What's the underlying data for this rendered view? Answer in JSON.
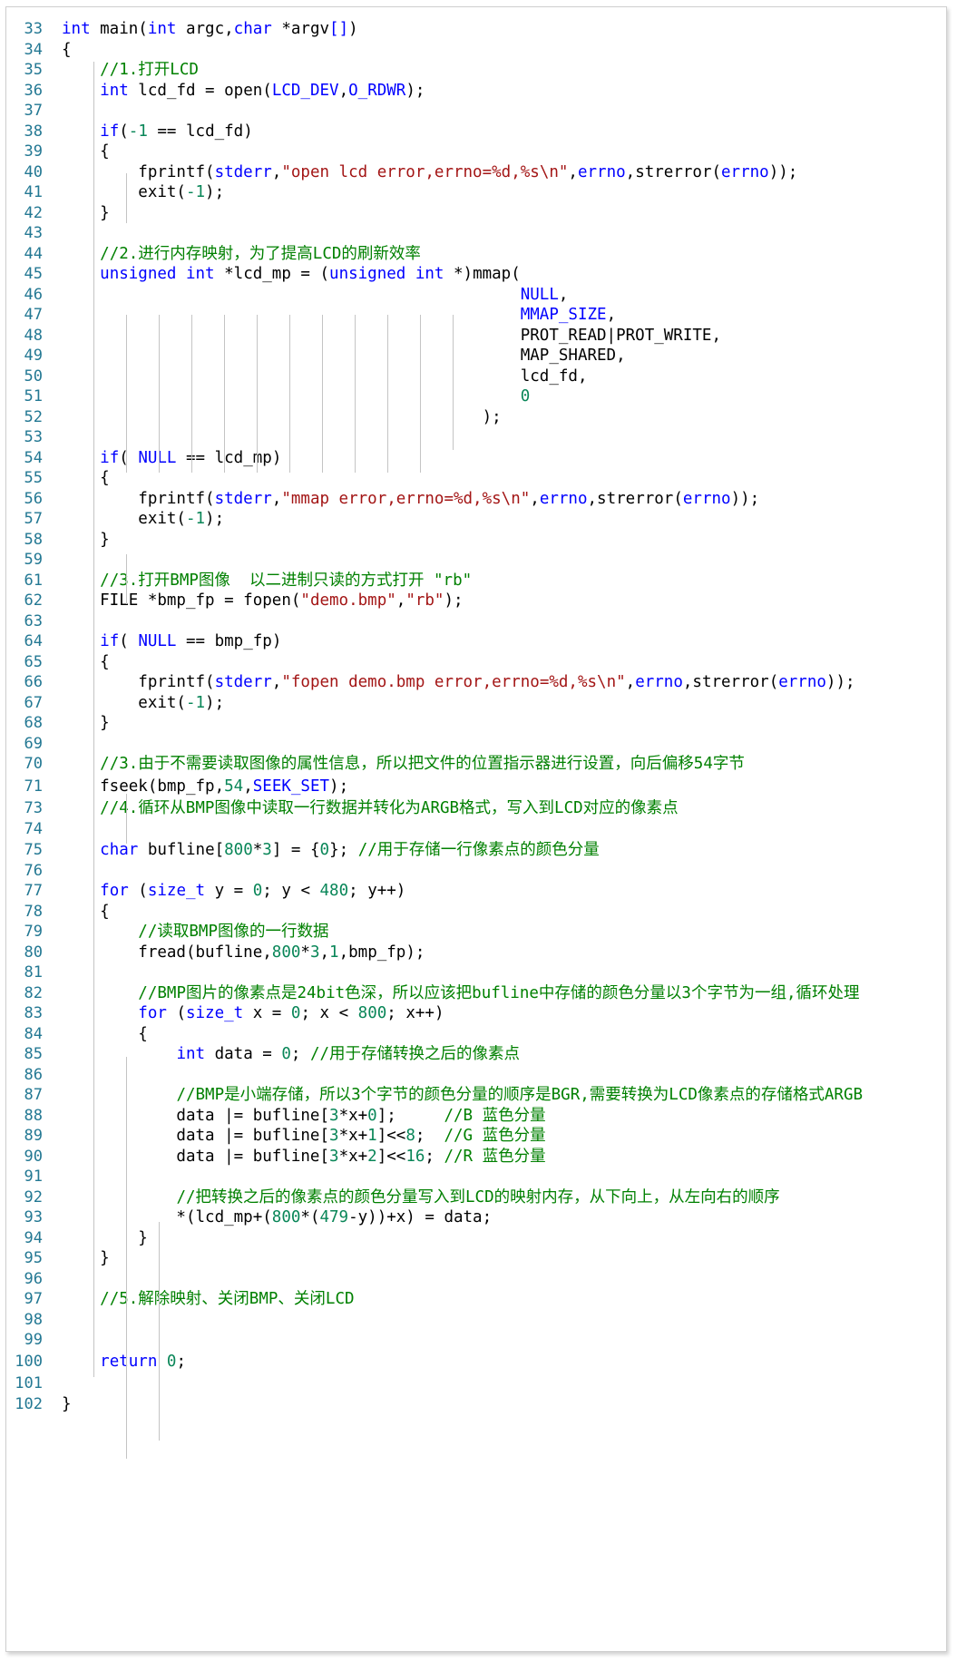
{
  "editor": {
    "colors": {
      "keyword": "#0000ff",
      "comment": "#008000",
      "string": "#a31515",
      "number": "#098658",
      "line_number": "#237893"
    },
    "lines": [
      {
        "n": "33",
        "segs": [
          [
            "kw",
            "int"
          ],
          [
            "",
            " main("
          ],
          [
            "kw",
            "int"
          ],
          [
            "",
            " argc,"
          ],
          [
            "kw",
            "char"
          ],
          [
            "",
            " *argv"
          ],
          [
            "kw",
            "[]"
          ],
          [
            "",
            ")"
          ]
        ]
      },
      {
        "n": "34",
        "segs": [
          [
            "",
            "{"
          ]
        ]
      },
      {
        "n": "35",
        "segs": [
          [
            "",
            "    "
          ],
          [
            "cm",
            "//1.打开LCD"
          ]
        ]
      },
      {
        "n": "36",
        "segs": [
          [
            "",
            "    "
          ],
          [
            "kw",
            "int"
          ],
          [
            "",
            " lcd_fd = open("
          ],
          [
            "mc",
            "LCD_DEV"
          ],
          [
            "",
            ","
          ],
          [
            "mc",
            "O_RDWR"
          ],
          [
            "",
            ");"
          ]
        ]
      },
      {
        "n": "37",
        "segs": []
      },
      {
        "n": "38",
        "segs": [
          [
            "",
            "    "
          ],
          [
            "kw",
            "if"
          ],
          [
            "",
            "("
          ],
          [
            "nm",
            "-1"
          ],
          [
            "",
            " == lcd_fd)"
          ]
        ]
      },
      {
        "n": "39",
        "segs": [
          [
            "",
            "    {"
          ]
        ]
      },
      {
        "n": "40",
        "segs": [
          [
            "",
            "        fprintf("
          ],
          [
            "mc",
            "stderr"
          ],
          [
            "",
            ","
          ],
          [
            "st",
            "\"open lcd error,errno=%d,%s\\n\""
          ],
          [
            "",
            ","
          ],
          [
            "mc",
            "errno"
          ],
          [
            "",
            ",strerror("
          ],
          [
            "mc",
            "errno"
          ],
          [
            "",
            "));"
          ]
        ]
      },
      {
        "n": "41",
        "segs": [
          [
            "",
            "        exit("
          ],
          [
            "nm",
            "-1"
          ],
          [
            "",
            ");"
          ]
        ]
      },
      {
        "n": "42",
        "segs": [
          [
            "",
            "    }"
          ]
        ]
      },
      {
        "n": "43",
        "segs": []
      },
      {
        "n": "44",
        "segs": [
          [
            "",
            "    "
          ],
          [
            "cm",
            "//2.进行内存映射，为了提高LCD的刷新效率"
          ]
        ]
      },
      {
        "n": "45",
        "segs": [
          [
            "",
            "    "
          ],
          [
            "kw",
            "unsigned int"
          ],
          [
            "",
            " *lcd_mp = ("
          ],
          [
            "kw",
            "unsigned int"
          ],
          [
            "",
            " *)mmap("
          ]
        ]
      },
      {
        "n": "46",
        "segs": [
          [
            "",
            "                                                "
          ],
          [
            "mc",
            "NULL"
          ],
          [
            "",
            ","
          ]
        ]
      },
      {
        "n": "47",
        "segs": [
          [
            "",
            "                                                "
          ],
          [
            "mc",
            "MMAP_SIZE"
          ],
          [
            "",
            ","
          ]
        ]
      },
      {
        "n": "48",
        "segs": [
          [
            "",
            "                                                PROT_READ|PROT_WRITE,"
          ]
        ]
      },
      {
        "n": "49",
        "segs": [
          [
            "",
            "                                                MAP_SHARED,"
          ]
        ]
      },
      {
        "n": "50",
        "segs": [
          [
            "",
            "                                                lcd_fd,"
          ]
        ]
      },
      {
        "n": "51",
        "segs": [
          [
            "",
            "                                                "
          ],
          [
            "nm",
            "0"
          ]
        ]
      },
      {
        "n": "52",
        "segs": [
          [
            "",
            "                                            );"
          ]
        ]
      },
      {
        "n": "53",
        "segs": []
      },
      {
        "n": "54",
        "segs": [
          [
            "",
            "    "
          ],
          [
            "kw",
            "if"
          ],
          [
            "",
            "( "
          ],
          [
            "mc",
            "NULL"
          ],
          [
            "",
            " == lcd_mp)"
          ]
        ]
      },
      {
        "n": "55",
        "segs": [
          [
            "",
            "    {"
          ]
        ]
      },
      {
        "n": "56",
        "segs": [
          [
            "",
            "        fprintf("
          ],
          [
            "mc",
            "stderr"
          ],
          [
            "",
            ","
          ],
          [
            "st",
            "\"mmap error,errno=%d,%s\\n\""
          ],
          [
            "",
            ","
          ],
          [
            "mc",
            "errno"
          ],
          [
            "",
            ",strerror("
          ],
          [
            "mc",
            "errno"
          ],
          [
            "",
            "));"
          ]
        ]
      },
      {
        "n": "57",
        "segs": [
          [
            "",
            "        exit("
          ],
          [
            "nm",
            "-1"
          ],
          [
            "",
            ");"
          ]
        ]
      },
      {
        "n": "58",
        "segs": [
          [
            "",
            "    }"
          ]
        ]
      },
      {
        "n": "59",
        "segs": []
      },
      {
        "n": "61",
        "segs": [
          [
            "",
            "    "
          ],
          [
            "cm",
            "//3.打开BMP图像  以二进制只读的方式打开 \"rb\""
          ]
        ]
      },
      {
        "n": "62",
        "segs": [
          [
            "",
            "    FILE *bmp_fp = fopen("
          ],
          [
            "st",
            "\"demo.bmp\""
          ],
          [
            "",
            ","
          ],
          [
            "st",
            "\"rb\""
          ],
          [
            "",
            ");"
          ]
        ]
      },
      {
        "n": "63",
        "segs": []
      },
      {
        "n": "64",
        "segs": [
          [
            "",
            "    "
          ],
          [
            "kw",
            "if"
          ],
          [
            "",
            "( "
          ],
          [
            "mc",
            "NULL"
          ],
          [
            "",
            " == bmp_fp)"
          ]
        ]
      },
      {
        "n": "65",
        "segs": [
          [
            "",
            "    {"
          ]
        ]
      },
      {
        "n": "66",
        "segs": [
          [
            "",
            "        fprintf("
          ],
          [
            "mc",
            "stderr"
          ],
          [
            "",
            ","
          ],
          [
            "st",
            "\"fopen demo.bmp error,errno=%d,%s\\n\""
          ],
          [
            "",
            ","
          ],
          [
            "mc",
            "errno"
          ],
          [
            "",
            ",strerror("
          ],
          [
            "mc",
            "errno"
          ],
          [
            "",
            "));"
          ]
        ]
      },
      {
        "n": "67",
        "segs": [
          [
            "",
            "        exit("
          ],
          [
            "nm",
            "-1"
          ],
          [
            "",
            ");"
          ]
        ]
      },
      {
        "n": "68",
        "segs": [
          [
            "",
            "    }"
          ]
        ]
      },
      {
        "n": "69",
        "segs": []
      },
      {
        "n": "70",
        "segs": [
          [
            "",
            "    "
          ],
          [
            "cm",
            "//3.由于不需要读取图像的属性信息，所以把文件的位置指示器进行设置，向后偏移54字节"
          ]
        ]
      },
      {
        "n": "71",
        "segs": [
          [
            "",
            "    fseek(bmp_fp,"
          ],
          [
            "nm",
            "54"
          ],
          [
            "",
            ","
          ],
          [
            "mc",
            "SEEK_SET"
          ],
          [
            "",
            ");"
          ]
        ]
      },
      {
        "n": "73",
        "segs": [
          [
            "",
            "    "
          ],
          [
            "cm",
            "//4.循环从BMP图像中读取一行数据并转化为ARGB格式，写入到LCD对应的像素点"
          ]
        ]
      },
      {
        "n": "74",
        "segs": []
      },
      {
        "n": "75",
        "segs": [
          [
            "",
            "    "
          ],
          [
            "kw",
            "char"
          ],
          [
            "",
            " bufline["
          ],
          [
            "nm",
            "800"
          ],
          [
            "",
            "*"
          ],
          [
            "nm",
            "3"
          ],
          [
            "",
            "] = {"
          ],
          [
            "nm",
            "0"
          ],
          [
            "",
            "}; "
          ],
          [
            "cm",
            "//用于存储一行像素点的颜色分量"
          ]
        ]
      },
      {
        "n": "76",
        "segs": []
      },
      {
        "n": "77",
        "segs": [
          [
            "",
            "    "
          ],
          [
            "kw",
            "for"
          ],
          [
            "",
            " ("
          ],
          [
            "kw",
            "size_t"
          ],
          [
            "",
            " y = "
          ],
          [
            "nm",
            "0"
          ],
          [
            "",
            "; y < "
          ],
          [
            "nm",
            "480"
          ],
          [
            "",
            "; y++)"
          ]
        ]
      },
      {
        "n": "78",
        "segs": [
          [
            "",
            "    {"
          ]
        ]
      },
      {
        "n": "79",
        "segs": [
          [
            "",
            "        "
          ],
          [
            "cm",
            "//读取BMP图像的一行数据"
          ]
        ]
      },
      {
        "n": "80",
        "segs": [
          [
            "",
            "        fread(bufline,"
          ],
          [
            "nm",
            "800"
          ],
          [
            "",
            "*"
          ],
          [
            "nm",
            "3"
          ],
          [
            "",
            ","
          ],
          [
            "nm",
            "1"
          ],
          [
            "",
            ",bmp_fp);"
          ]
        ]
      },
      {
        "n": "81",
        "segs": []
      },
      {
        "n": "82",
        "segs": [
          [
            "",
            "        "
          ],
          [
            "cm",
            "//BMP图片的像素点是24bit色深，所以应该把bufline中存储的颜色分量以3个字节为一组,循环处理"
          ]
        ]
      },
      {
        "n": "83",
        "segs": [
          [
            "",
            "        "
          ],
          [
            "kw",
            "for"
          ],
          [
            "",
            " ("
          ],
          [
            "kw",
            "size_t"
          ],
          [
            "",
            " x = "
          ],
          [
            "nm",
            "0"
          ],
          [
            "",
            "; x < "
          ],
          [
            "nm",
            "800"
          ],
          [
            "",
            "; x++)"
          ]
        ]
      },
      {
        "n": "84",
        "segs": [
          [
            "",
            "        {"
          ]
        ]
      },
      {
        "n": "85",
        "segs": [
          [
            "",
            "            "
          ],
          [
            "kw",
            "int"
          ],
          [
            "",
            " data = "
          ],
          [
            "nm",
            "0"
          ],
          [
            "",
            "; "
          ],
          [
            "cm",
            "//用于存储转换之后的像素点"
          ]
        ]
      },
      {
        "n": "86",
        "segs": []
      },
      {
        "n": "87",
        "segs": [
          [
            "",
            "            "
          ],
          [
            "cm",
            "//BMP是小端存储，所以3个字节的颜色分量的顺序是BGR,需要转换为LCD像素点的存储格式ARGB"
          ]
        ]
      },
      {
        "n": "88",
        "segs": [
          [
            "",
            "            data |= bufline["
          ],
          [
            "nm",
            "3"
          ],
          [
            "",
            "*x+"
          ],
          [
            "nm",
            "0"
          ],
          [
            "",
            "];     "
          ],
          [
            "cm",
            "//B 蓝色分量"
          ]
        ]
      },
      {
        "n": "89",
        "segs": [
          [
            "",
            "            data |= bufline["
          ],
          [
            "nm",
            "3"
          ],
          [
            "",
            "*x+"
          ],
          [
            "nm",
            "1"
          ],
          [
            "",
            "]<<"
          ],
          [
            "nm",
            "8"
          ],
          [
            "",
            ";  "
          ],
          [
            "cm",
            "//G 蓝色分量"
          ]
        ]
      },
      {
        "n": "90",
        "segs": [
          [
            "",
            "            data |= bufline["
          ],
          [
            "nm",
            "3"
          ],
          [
            "",
            "*x+"
          ],
          [
            "nm",
            "2"
          ],
          [
            "",
            "]<<"
          ],
          [
            "nm",
            "16"
          ],
          [
            "",
            "; "
          ],
          [
            "cm",
            "//R 蓝色分量"
          ]
        ]
      },
      {
        "n": "91",
        "segs": []
      },
      {
        "n": "92",
        "segs": [
          [
            "",
            "            "
          ],
          [
            "cm",
            "//把转换之后的像素点的颜色分量写入到LCD的映射内存，从下向上，从左向右的顺序"
          ]
        ]
      },
      {
        "n": "93",
        "segs": [
          [
            "",
            "            *(lcd_mp+("
          ],
          [
            "nm",
            "800"
          ],
          [
            "",
            "*("
          ],
          [
            "nm",
            "479"
          ],
          [
            "",
            "-y))+x) = data;"
          ]
        ]
      },
      {
        "n": "94",
        "segs": [
          [
            "",
            "        }"
          ]
        ]
      },
      {
        "n": "95",
        "segs": [
          [
            "",
            "    }"
          ]
        ]
      },
      {
        "n": "96",
        "segs": []
      },
      {
        "n": "97",
        "segs": [
          [
            "",
            "    "
          ],
          [
            "cm",
            "//5.解除映射、关闭BMP、关闭LCD"
          ]
        ]
      },
      {
        "n": "98",
        "segs": []
      },
      {
        "n": "99",
        "segs": []
      },
      {
        "n": "100",
        "segs": [
          [
            "",
            "    "
          ],
          [
            "kw",
            "return"
          ],
          [
            "",
            " "
          ],
          [
            "nm",
            "0"
          ],
          [
            "",
            ";"
          ]
        ]
      },
      {
        "n": "101",
        "segs": []
      },
      {
        "n": "102",
        "segs": [
          [
            "",
            "}"
          ]
        ]
      }
    ]
  }
}
